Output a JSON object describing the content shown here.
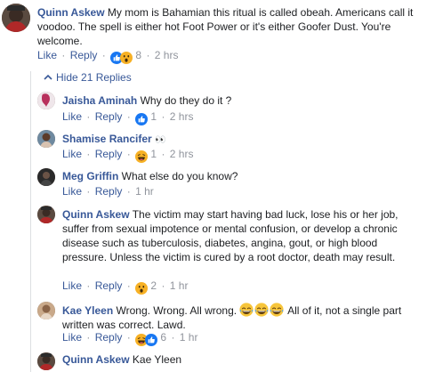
{
  "comments": [
    {
      "name": "Quinn Askew",
      "text": "My mom is Bahamian this ritual is called obeah. Americans call it voodoo. The spell is either hot Foot Power or it's either Goofer Dust. You're welcome.",
      "like": "Like",
      "reply": "Reply",
      "reactions": [
        "like",
        "wow"
      ],
      "count": "8",
      "time": "2 hrs"
    }
  ],
  "hide_replies": "Hide 21 Replies",
  "replies": [
    {
      "name": "Jaisha Aminah",
      "text": "Why do they do it ?",
      "like": "Like",
      "reply": "Reply",
      "reactions": [
        "like"
      ],
      "count": "1",
      "time": "2 hrs"
    },
    {
      "name": "Shamise Rancifer",
      "text": "👀",
      "like": "Like",
      "reply": "Reply",
      "reactions": [
        "haha"
      ],
      "count": "1",
      "time": "2 hrs"
    },
    {
      "name": "Meg Griffin",
      "text": "What else do you know?",
      "like": "Like",
      "reply": "Reply",
      "time": "1 hr"
    },
    {
      "name": "Quinn Askew",
      "text": "The victim may start having bad luck, lose his or her job, suffer from sexual impotence or mental confusion, or develop a chronic disease such as tuberculosis, diabetes, angina, gout, or high blood pressure. Unless the victim is cured by a root doctor, death may result.",
      "like": "Like",
      "reply": "Reply",
      "reactions": [
        "wow"
      ],
      "count": "2",
      "time": "1 hr"
    },
    {
      "name": "Kae Yleen",
      "text_before": "Wrong. Wrong. All wrong.",
      "text_after": "All of it, not a single part written was correct. Lawd.",
      "like": "Like",
      "reply": "Reply",
      "reactions": [
        "haha",
        "like"
      ],
      "count": "6",
      "time": "1 hr"
    },
    {
      "name": "Quinn Askew",
      "text": "Kae Yleen"
    }
  ],
  "colors": {
    "link": "#385898",
    "meta": "#90949c",
    "text": "#1c1e21",
    "like_blue": "#1877f2",
    "emoji_yellow": "#f7b125"
  },
  "icons": [
    "like-reaction-icon",
    "wow-reaction-icon",
    "haha-reaction-icon",
    "eyes-emoji-icon",
    "laughing-emoji-icon",
    "chevron-up-icon"
  ]
}
